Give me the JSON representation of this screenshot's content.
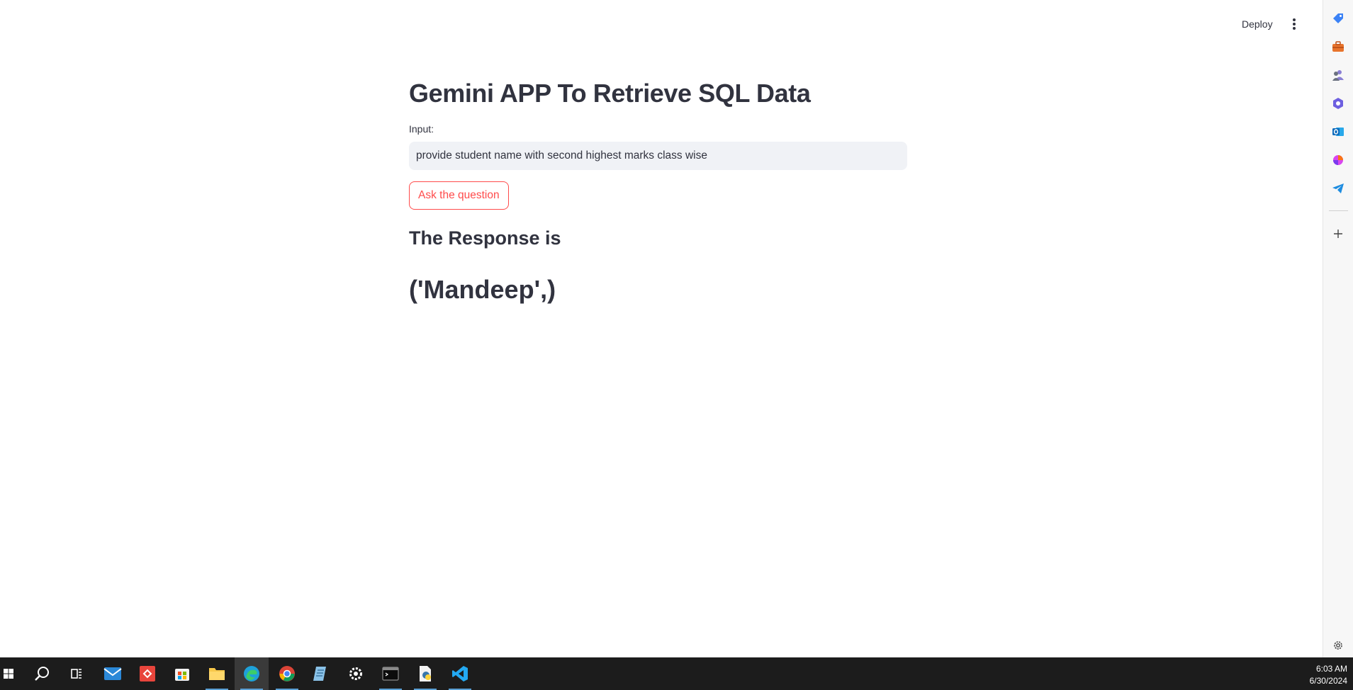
{
  "header": {
    "deploy_label": "Deploy",
    "menu_icon": "kebab-menu-icon"
  },
  "main": {
    "title": "Gemini APP To Retrieve SQL Data",
    "input_label": "Input:",
    "input_value": "provide student name with second highest marks class wise",
    "ask_button_label": "Ask the question",
    "response_header": "The Response is",
    "response_value": "('Mandeep',)"
  },
  "edge_sidebar": {
    "items": [
      "tag-icon",
      "briefcase-icon",
      "people-icon",
      "copilot-icon",
      "outlook-icon",
      "designer-icon",
      "telegram-icon",
      "add-icon"
    ],
    "settings_icon": "gear-icon"
  },
  "taskbar": {
    "apps": [
      "start-icon",
      "search-icon",
      "task-view-icon",
      "mail-icon",
      "git-icon",
      "store-icon",
      "file-explorer-icon",
      "edge-icon",
      "chrome-icon",
      "notepad-icon",
      "settings-icon",
      "terminal-icon",
      "python-icon",
      "vscode-icon"
    ],
    "time": "6:03 AM",
    "date": "6/30/2024"
  },
  "colors": {
    "accent": "#ff4b4b",
    "text": "#31333f",
    "input_bg": "#f0f2f6",
    "taskbar_bg": "#1c1c1c"
  }
}
